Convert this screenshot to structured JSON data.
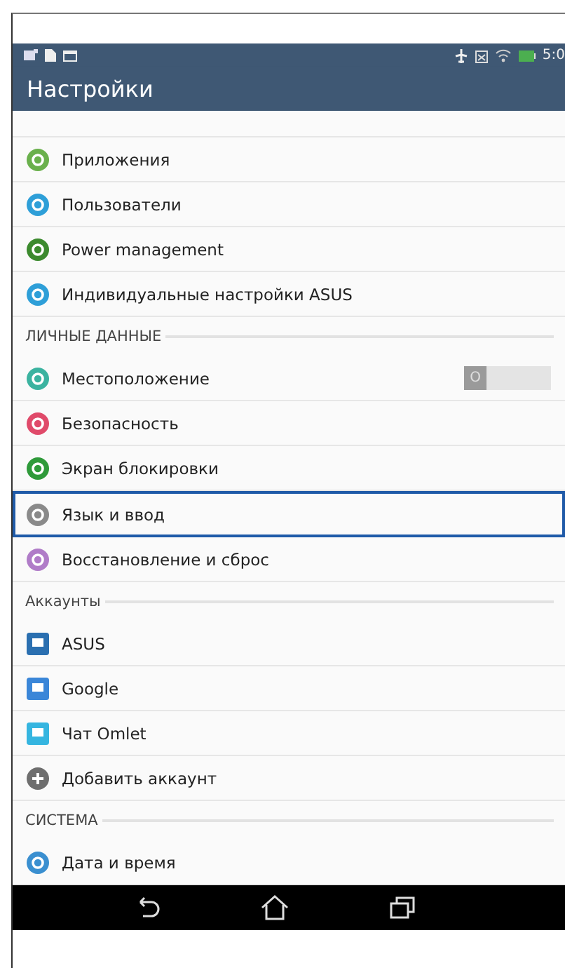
{
  "status_bar": {
    "time": "5:0"
  },
  "action_bar": {
    "title": "Настройки"
  },
  "sections": [
    {
      "items": [
        {
          "kind": "setting",
          "label": "Приложения",
          "color": "#6ab04c",
          "selected": false
        },
        {
          "kind": "setting",
          "label": "Пользователи",
          "color": "#2e9fd8",
          "selected": false
        },
        {
          "kind": "setting",
          "label": "Power management",
          "color": "#3c8a2e",
          "selected": false
        },
        {
          "kind": "setting",
          "label": "Индивидуальные настройки ASUS",
          "color": "#2e9fd8",
          "selected": false
        }
      ]
    },
    {
      "header": "ЛИЧНЫЕ ДАННЫЕ",
      "items": [
        {
          "kind": "switch",
          "label": "Местоположение",
          "color": "#3bb3a0",
          "selected": false,
          "on": false,
          "switch_text": "O"
        },
        {
          "kind": "setting",
          "label": "Безопасность",
          "color": "#e04a6a",
          "selected": false
        },
        {
          "kind": "setting",
          "label": "Экран блокировки",
          "color": "#2f9a3a",
          "selected": false
        },
        {
          "kind": "setting",
          "label": "Язык и ввод",
          "color": "#8a8a8a",
          "selected": true
        },
        {
          "kind": "setting",
          "label": "Восстановление и сброс",
          "color": "#b07cc8",
          "selected": false
        }
      ]
    },
    {
      "header": "Аккаунты",
      "items": [
        {
          "kind": "account",
          "label": "ASUS",
          "color": "#2a6fb0",
          "selected": false
        },
        {
          "kind": "account",
          "label": "Google",
          "color": "#3a86d8",
          "selected": false
        },
        {
          "kind": "account",
          "label": "Чат Omlet",
          "color": "#35b5e0",
          "selected": false
        },
        {
          "kind": "add",
          "label": "Добавить аккаунт",
          "color": "#6e6e6e",
          "selected": false
        }
      ]
    },
    {
      "header": "СИСТЕМА",
      "items": [
        {
          "kind": "setting",
          "label": "Дата и время",
          "color": "#3a8fd0",
          "selected": false
        }
      ]
    }
  ]
}
